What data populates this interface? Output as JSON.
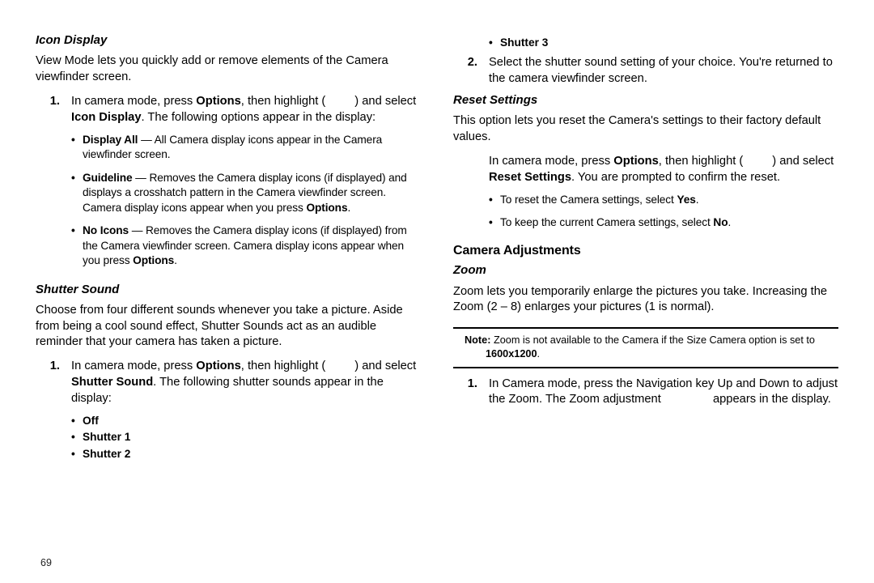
{
  "page_number": "69",
  "left": {
    "icon_display": {
      "heading": "Icon Display",
      "intro": "View Mode lets you quickly add or remove elements of the Camera viewfinder screen.",
      "step1_pre": "In camera mode, press ",
      "step1_options": "Options",
      "step1_mid": ", then highlight (",
      "step1_post": ") and select ",
      "step1_sel": "Icon Display",
      "step1_tail": ". The following options appear in the display:",
      "sub": {
        "display_all_label": "Display All",
        "display_all_desc": " — All Camera display icons appear in the Camera viewfinder screen.",
        "guideline_label": "Guideline",
        "guideline_desc": " — Removes the Camera display icons (if displayed) and displays a crosshatch pattern in the Camera viewfinder screen. Camera display icons appear when you press ",
        "guideline_opt": "Options",
        "guideline_period": ".",
        "noicons_label": "No Icons",
        "noicons_desc": " — Removes the Camera display icons (if displayed) from the Camera viewfinder screen. Camera display icons appear when you press ",
        "noicons_opt": "Options",
        "noicons_period": "."
      }
    },
    "shutter_sound": {
      "heading": "Shutter Sound",
      "intro": "Choose from four different sounds whenever you take a picture. Aside from being a cool sound effect, Shutter Sounds act as an audible reminder that your camera has taken a picture.",
      "step1_pre": "In camera mode, press ",
      "step1_options": "Options",
      "step1_mid": ", then highlight (",
      "step1_post": ") and select ",
      "step1_sel": "Shutter Sound",
      "step1_tail": ". The following shutter sounds appear in the display:",
      "item_off": "Off",
      "item_s1": "Shutter 1",
      "item_s2": "Shutter 2"
    }
  },
  "right": {
    "shutter3": "Shutter 3",
    "step2": "Select the shutter sound setting of your choice. You're returned to the camera viewfinder screen.",
    "reset": {
      "heading": "Reset Settings",
      "intro": "This option lets you reset the Camera's settings to their factory default values.",
      "line_pre": "In camera mode, press ",
      "line_options": "Options",
      "line_mid": ", then highlight (",
      "line_post": ") and select ",
      "line_sel": "Reset Settings",
      "line_tail": ". You are prompted to confirm the reset.",
      "yes_pre": "To reset the Camera settings, select ",
      "yes": "Yes",
      "yes_post": ".",
      "no_pre": "To keep the current Camera settings, select ",
      "no": "No",
      "no_post": "."
    },
    "camera_adj_heading": "Camera Adjustments",
    "zoom": {
      "heading": "Zoom",
      "intro": "Zoom lets you temporarily enlarge the pictures you take. Increasing the Zoom (2 – 8) enlarges your pictures (1 is normal).",
      "note_label": "Note:",
      "note_pre": "Zoom is not available to the Camera if the Size Camera option is set to ",
      "note_res": "1600x1200",
      "note_post": ".",
      "step1_pre": "In Camera mode, press the Navigation key Up and Down to adjust the Zoom. The Zoom adjustment ",
      "step1_tail": " appears in the display."
    }
  }
}
